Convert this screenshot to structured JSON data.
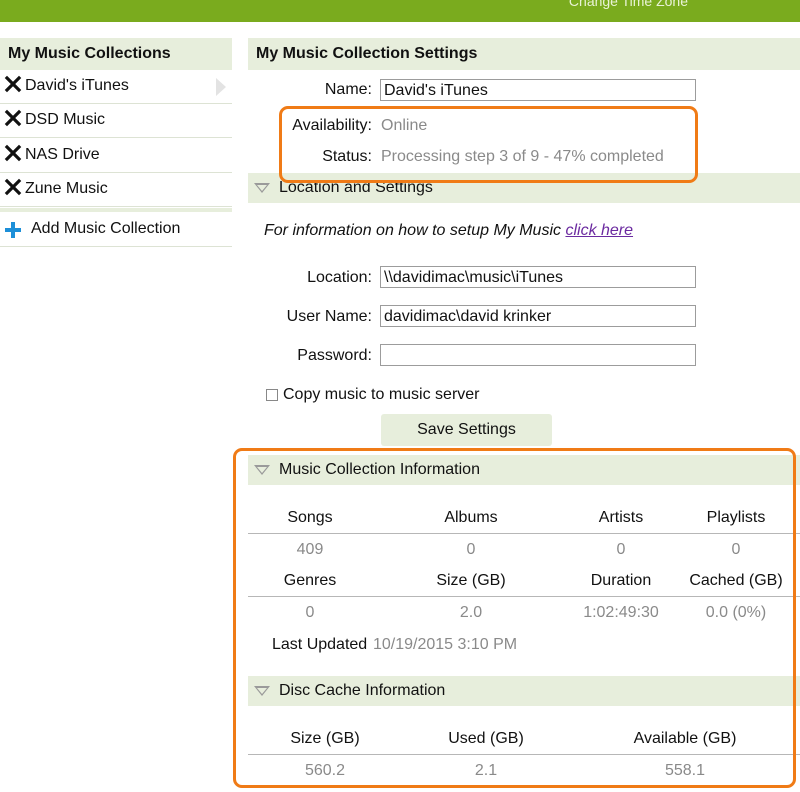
{
  "topbar": {
    "link": "Change Time Zone"
  },
  "sidebar": {
    "title": "My Music Collections",
    "items": [
      {
        "label": "David's iTunes"
      },
      {
        "label": "DSD Music"
      },
      {
        "label": "NAS Drive"
      },
      {
        "label": "Zune Music"
      }
    ],
    "add_label": "Add Music Collection"
  },
  "settings": {
    "title": "My Music Collection Settings",
    "name_label": "Name:",
    "name_value": "David's iTunes",
    "availability_label": "Availability:",
    "availability_value": "Online",
    "status_label": "Status:",
    "status_value": "Processing step 3 of 9 - 47% completed"
  },
  "location": {
    "section_title": "Location and Settings",
    "info_text": "For information on how to setup My Music ",
    "info_link": "click here",
    "location_label": "Location:",
    "location_value": "\\\\davidimac\\music\\iTunes",
    "username_label": "User Name:",
    "username_value": "davidimac\\david krinker",
    "password_label": "Password:",
    "password_value": "",
    "copy_label": "Copy music to music server",
    "save_label": "Save Settings"
  },
  "collection_info": {
    "section_title": "Music Collection Information",
    "row1_headers": [
      "Songs",
      "Albums",
      "Artists",
      "Playlists"
    ],
    "row1_values": [
      "409",
      "0",
      "0",
      "0"
    ],
    "row2_headers": [
      "Genres",
      "Size (GB)",
      "Duration",
      "Cached (GB)"
    ],
    "row2_values": [
      "0",
      "2.0",
      "1:02:49:30",
      "0.0 (0%)"
    ],
    "last_updated_label": "Last Updated",
    "last_updated_value": "10/19/2015 3:10 PM"
  },
  "disc_cache": {
    "section_title": "Disc Cache Information",
    "headers": [
      "Size (GB)",
      "Used (GB)",
      "Available (GB)"
    ],
    "values": [
      "560.2",
      "2.1",
      "558.1"
    ]
  },
  "colors": {
    "accent": "#7aab1e",
    "panel": "#e7eedc",
    "highlight": "#f07b16",
    "link": "#6b2aa0"
  }
}
